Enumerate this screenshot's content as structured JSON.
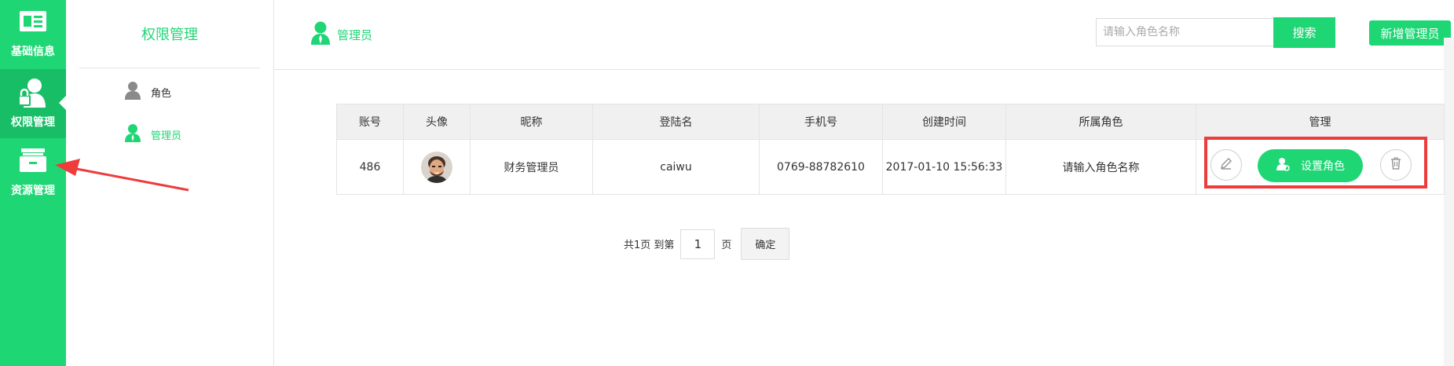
{
  "iconbar": {
    "items": [
      {
        "label": "基础信息",
        "icon": "id-card-icon"
      },
      {
        "label": "权限管理",
        "icon": "user-lock-icon"
      },
      {
        "label": "资源管理",
        "icon": "cabinet-icon"
      }
    ],
    "active_index": 1
  },
  "subnav": {
    "title": "权限管理",
    "items": [
      {
        "label": "角色",
        "icon": "user-icon"
      },
      {
        "label": "管理员",
        "icon": "admin-user-icon"
      }
    ],
    "active_index": 1
  },
  "header": {
    "breadcrumb": "管理员",
    "search_placeholder": "请输入角色名称",
    "search_label": "搜索",
    "add_label": "新增管理员"
  },
  "table": {
    "columns": [
      "账号",
      "头像",
      "昵称",
      "登陆名",
      "手机号",
      "创建时间",
      "所属角色",
      "管理"
    ],
    "rows": [
      {
        "account": "486",
        "nickname": "财务管理员",
        "login": "caiwu",
        "phone": "0769-88782610",
        "created": "2017-01-10 15:56:33",
        "role": "请输入角色名称",
        "set_role_label": "设置角色"
      }
    ]
  },
  "pager": {
    "total_text": "共1页 到第",
    "page_value": "1",
    "page_suffix": "页",
    "confirm_label": "确定"
  },
  "colors": {
    "accent": "#1fd675",
    "accent_dark": "#17be66",
    "highlight": "#ee3b3b"
  }
}
